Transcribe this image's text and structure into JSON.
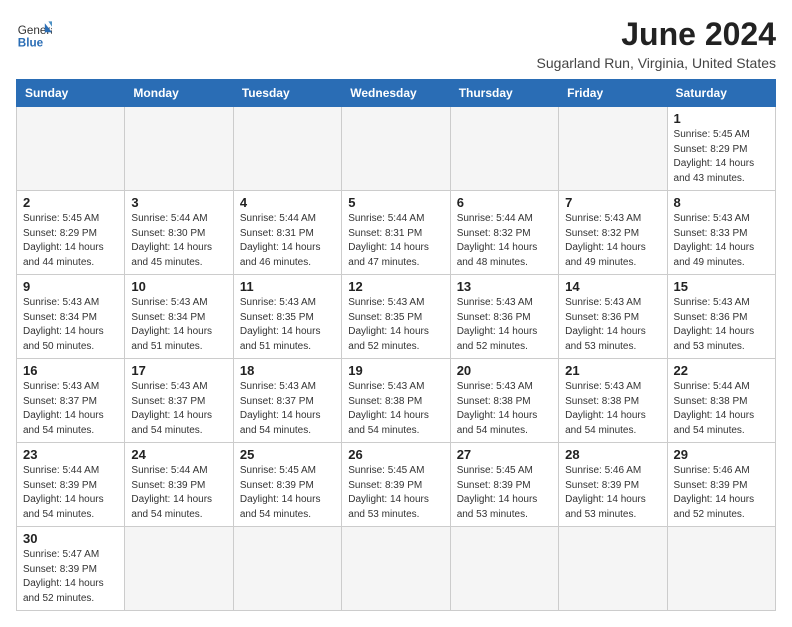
{
  "header": {
    "logo_general": "General",
    "logo_blue": "Blue",
    "title": "June 2024",
    "subtitle": "Sugarland Run, Virginia, United States"
  },
  "days_of_week": [
    "Sunday",
    "Monday",
    "Tuesday",
    "Wednesday",
    "Thursday",
    "Friday",
    "Saturday"
  ],
  "weeks": [
    [
      {
        "day": "",
        "info": ""
      },
      {
        "day": "",
        "info": ""
      },
      {
        "day": "",
        "info": ""
      },
      {
        "day": "",
        "info": ""
      },
      {
        "day": "",
        "info": ""
      },
      {
        "day": "",
        "info": ""
      },
      {
        "day": "1",
        "info": "Sunrise: 5:45 AM\nSunset: 8:29 PM\nDaylight: 14 hours\nand 43 minutes."
      }
    ],
    [
      {
        "day": "2",
        "info": "Sunrise: 5:45 AM\nSunset: 8:29 PM\nDaylight: 14 hours\nand 44 minutes."
      },
      {
        "day": "3",
        "info": "Sunrise: 5:44 AM\nSunset: 8:30 PM\nDaylight: 14 hours\nand 45 minutes."
      },
      {
        "day": "4",
        "info": "Sunrise: 5:44 AM\nSunset: 8:31 PM\nDaylight: 14 hours\nand 46 minutes."
      },
      {
        "day": "5",
        "info": "Sunrise: 5:44 AM\nSunset: 8:31 PM\nDaylight: 14 hours\nand 47 minutes."
      },
      {
        "day": "6",
        "info": "Sunrise: 5:44 AM\nSunset: 8:32 PM\nDaylight: 14 hours\nand 48 minutes."
      },
      {
        "day": "7",
        "info": "Sunrise: 5:43 AM\nSunset: 8:32 PM\nDaylight: 14 hours\nand 49 minutes."
      },
      {
        "day": "8",
        "info": "Sunrise: 5:43 AM\nSunset: 8:33 PM\nDaylight: 14 hours\nand 49 minutes."
      }
    ],
    [
      {
        "day": "9",
        "info": "Sunrise: 5:43 AM\nSunset: 8:34 PM\nDaylight: 14 hours\nand 50 minutes."
      },
      {
        "day": "10",
        "info": "Sunrise: 5:43 AM\nSunset: 8:34 PM\nDaylight: 14 hours\nand 51 minutes."
      },
      {
        "day": "11",
        "info": "Sunrise: 5:43 AM\nSunset: 8:35 PM\nDaylight: 14 hours\nand 51 minutes."
      },
      {
        "day": "12",
        "info": "Sunrise: 5:43 AM\nSunset: 8:35 PM\nDaylight: 14 hours\nand 52 minutes."
      },
      {
        "day": "13",
        "info": "Sunrise: 5:43 AM\nSunset: 8:36 PM\nDaylight: 14 hours\nand 52 minutes."
      },
      {
        "day": "14",
        "info": "Sunrise: 5:43 AM\nSunset: 8:36 PM\nDaylight: 14 hours\nand 53 minutes."
      },
      {
        "day": "15",
        "info": "Sunrise: 5:43 AM\nSunset: 8:36 PM\nDaylight: 14 hours\nand 53 minutes."
      }
    ],
    [
      {
        "day": "16",
        "info": "Sunrise: 5:43 AM\nSunset: 8:37 PM\nDaylight: 14 hours\nand 54 minutes."
      },
      {
        "day": "17",
        "info": "Sunrise: 5:43 AM\nSunset: 8:37 PM\nDaylight: 14 hours\nand 54 minutes."
      },
      {
        "day": "18",
        "info": "Sunrise: 5:43 AM\nSunset: 8:37 PM\nDaylight: 14 hours\nand 54 minutes."
      },
      {
        "day": "19",
        "info": "Sunrise: 5:43 AM\nSunset: 8:38 PM\nDaylight: 14 hours\nand 54 minutes."
      },
      {
        "day": "20",
        "info": "Sunrise: 5:43 AM\nSunset: 8:38 PM\nDaylight: 14 hours\nand 54 minutes."
      },
      {
        "day": "21",
        "info": "Sunrise: 5:43 AM\nSunset: 8:38 PM\nDaylight: 14 hours\nand 54 minutes."
      },
      {
        "day": "22",
        "info": "Sunrise: 5:44 AM\nSunset: 8:38 PM\nDaylight: 14 hours\nand 54 minutes."
      }
    ],
    [
      {
        "day": "23",
        "info": "Sunrise: 5:44 AM\nSunset: 8:39 PM\nDaylight: 14 hours\nand 54 minutes."
      },
      {
        "day": "24",
        "info": "Sunrise: 5:44 AM\nSunset: 8:39 PM\nDaylight: 14 hours\nand 54 minutes."
      },
      {
        "day": "25",
        "info": "Sunrise: 5:45 AM\nSunset: 8:39 PM\nDaylight: 14 hours\nand 54 minutes."
      },
      {
        "day": "26",
        "info": "Sunrise: 5:45 AM\nSunset: 8:39 PM\nDaylight: 14 hours\nand 53 minutes."
      },
      {
        "day": "27",
        "info": "Sunrise: 5:45 AM\nSunset: 8:39 PM\nDaylight: 14 hours\nand 53 minutes."
      },
      {
        "day": "28",
        "info": "Sunrise: 5:46 AM\nSunset: 8:39 PM\nDaylight: 14 hours\nand 53 minutes."
      },
      {
        "day": "29",
        "info": "Sunrise: 5:46 AM\nSunset: 8:39 PM\nDaylight: 14 hours\nand 52 minutes."
      }
    ],
    [
      {
        "day": "30",
        "info": "Sunrise: 5:47 AM\nSunset: 8:39 PM\nDaylight: 14 hours\nand 52 minutes."
      },
      {
        "day": "",
        "info": ""
      },
      {
        "day": "",
        "info": ""
      },
      {
        "day": "",
        "info": ""
      },
      {
        "day": "",
        "info": ""
      },
      {
        "day": "",
        "info": ""
      },
      {
        "day": "",
        "info": ""
      }
    ]
  ]
}
